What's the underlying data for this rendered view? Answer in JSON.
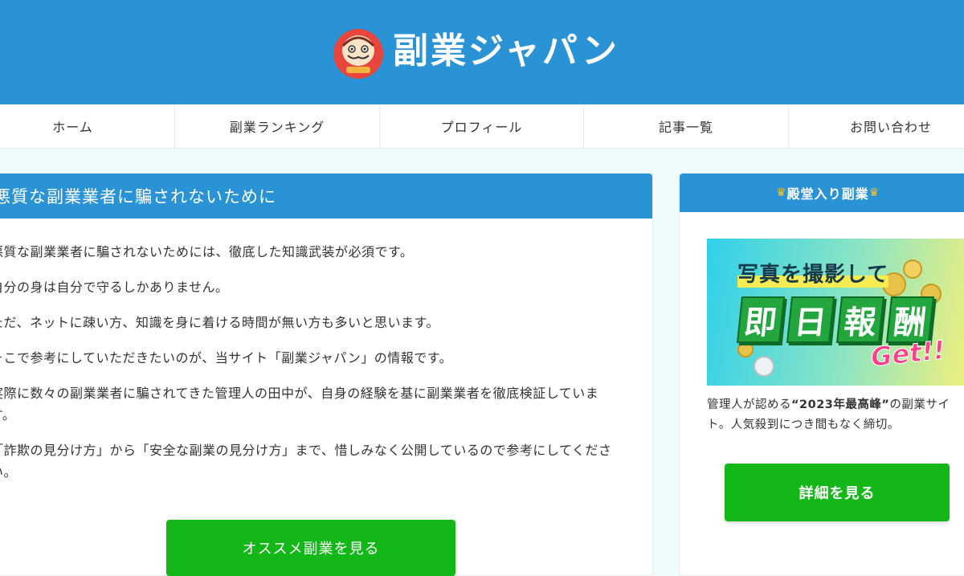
{
  "site": {
    "logo_text": "副業ジャパン",
    "logo_icon": "daruma-icon"
  },
  "nav": {
    "items": [
      "ホーム",
      "副業ランキング",
      "プロフィール",
      "記事一覧",
      "お問い合わせ"
    ]
  },
  "main": {
    "heading": "悪質な副業業者に騙されないために",
    "paragraphs": [
      "悪質な副業業者に騙されないためには、徹底した知識武装が必須です。",
      "自分の身は自分で守るしかありません。",
      "ただ、ネットに疎い方、知識を身に着ける時間が無い方も多いと思います。",
      "そこで参考にしていただきたいのが、当サイト「副業ジャパン」の情報です。",
      "実際に数々の副業業者に騙されてきた管理人の田中が、自身の経験を基に副業業者を徹底検証しています。",
      "「詐欺の見分け方」から「安全な副業の見分け方」まで、惜しみなく公開しているので参考にしてください。"
    ],
    "cta_label": "オススメ副業を見る"
  },
  "sidebar": {
    "heading": "殿堂入り副業",
    "crown_icon": "crown-icon",
    "banner": {
      "subtitle": "写真を撮影して",
      "kanji": [
        "即",
        "日",
        "報",
        "酬"
      ],
      "get": "Get!!"
    },
    "desc_prefix": "管理人が認める",
    "desc_highlight": "“2023年最高峰”",
    "desc_suffix": "の副業サイト。人気殺到につき間もなく締切。",
    "cta_label": "詳細を見る"
  },
  "colors": {
    "header_blue": "#2a93d5",
    "cta_green": "#13b818",
    "page_bg": "#f0fcfc"
  }
}
